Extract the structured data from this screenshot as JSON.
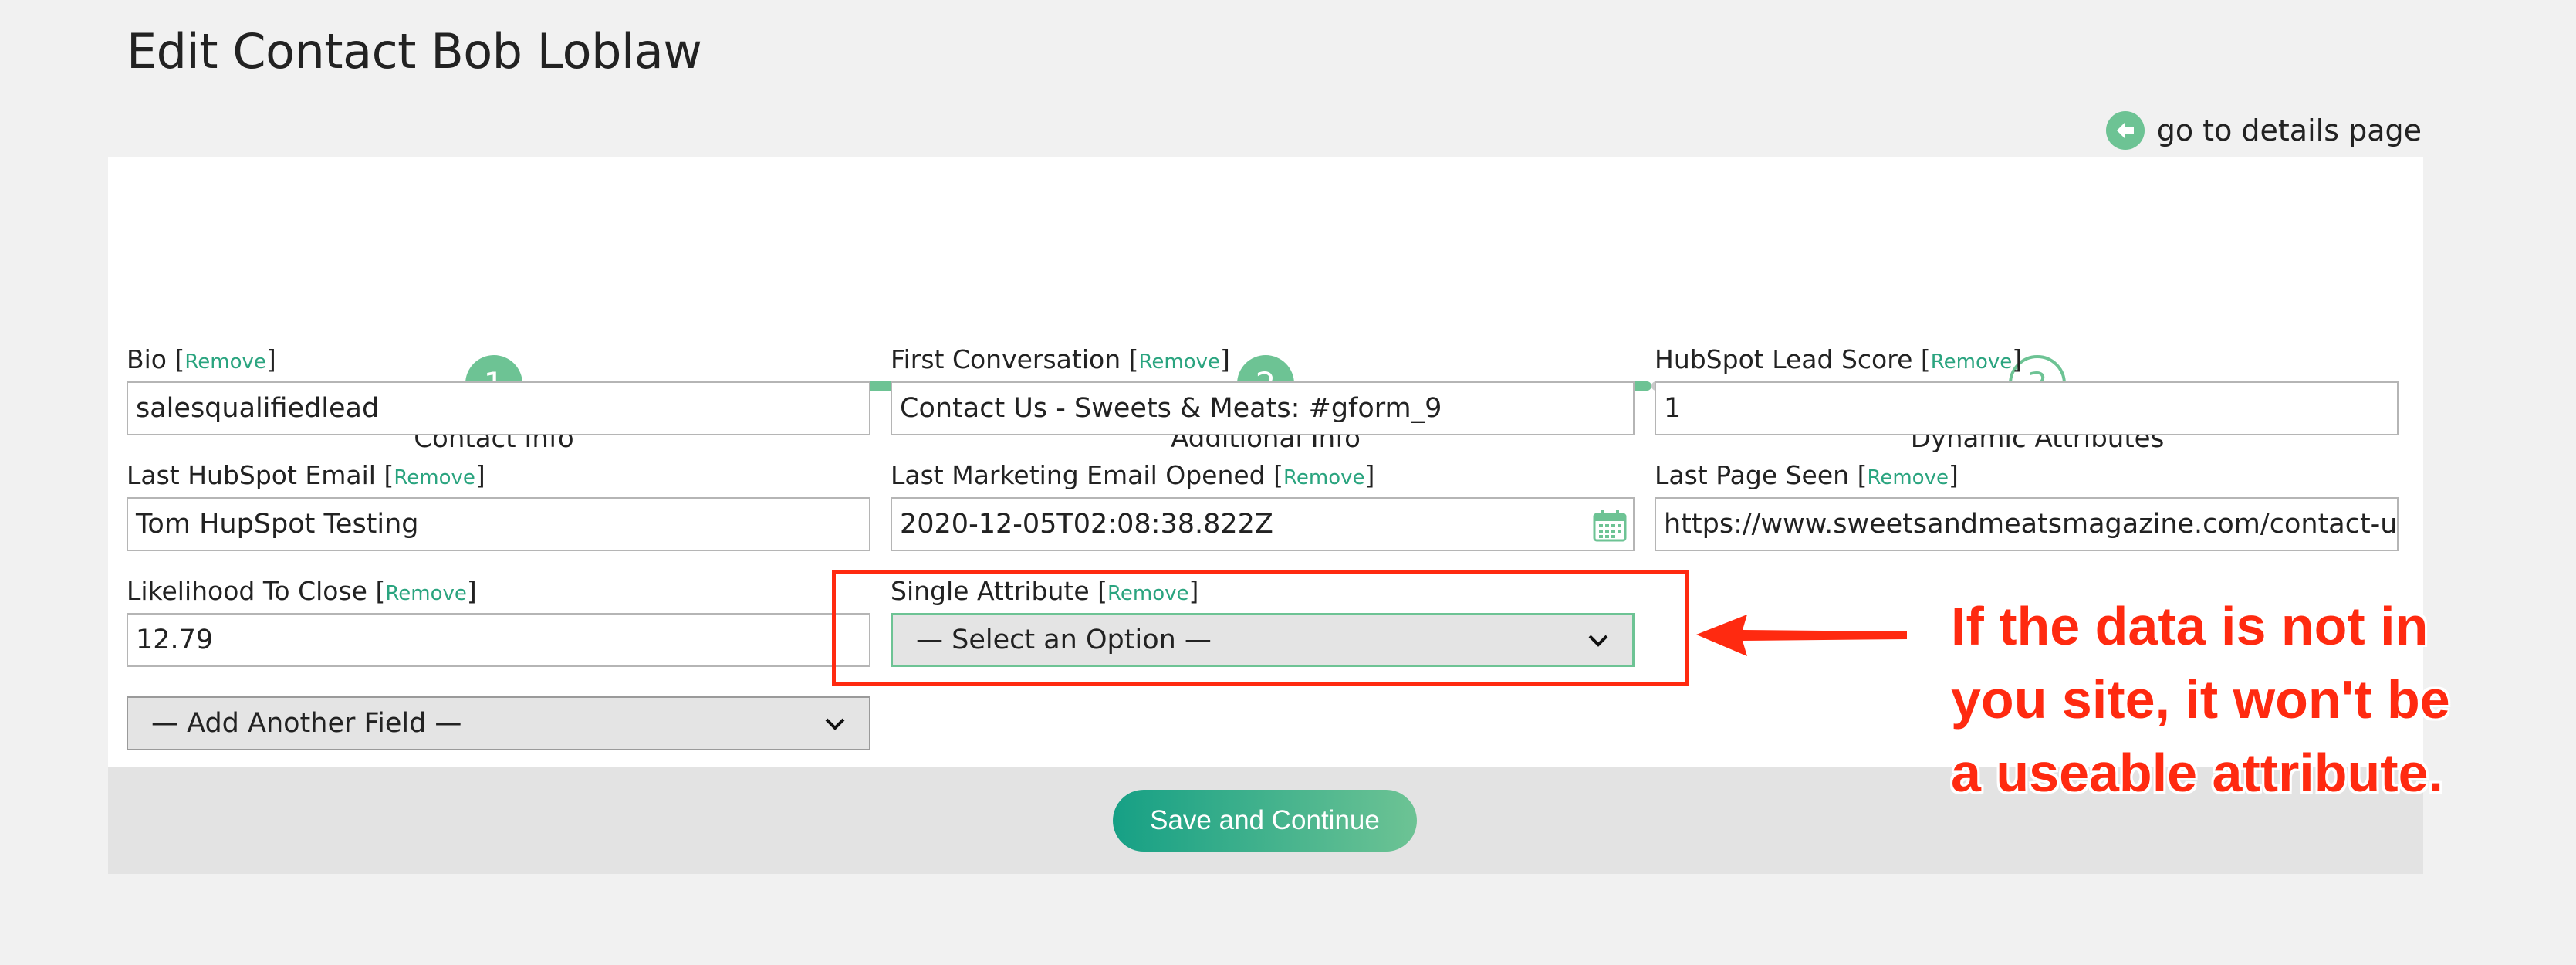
{
  "page": {
    "title": "Edit Contact Bob Loblaw",
    "details_link": "go to details page"
  },
  "steps": [
    {
      "number": "1",
      "label": "Contact Info",
      "state": "complete"
    },
    {
      "number": "2",
      "label": "Additional Info",
      "state": "complete"
    },
    {
      "number": "3",
      "label": "Dynamic Attributes",
      "state": "pending"
    }
  ],
  "remove_label": "Remove",
  "fields": {
    "bio": {
      "label": "Bio",
      "value": "salesqualifiedlead"
    },
    "first_conversation": {
      "label": "First Conversation",
      "value": "Contact Us - Sweets & Meats: #gform_9"
    },
    "hubspot_lead_score": {
      "label": "HubSpot Lead Score",
      "value": "1"
    },
    "last_hubspot_email": {
      "label": "Last HubSpot Email",
      "value": "Tom HupSpot Testing"
    },
    "last_marketing_email_opened": {
      "label": "Last Marketing Email Opened",
      "value": "2020-12-05T02:08:38.822Z"
    },
    "last_page_seen": {
      "label": "Last Page Seen",
      "value": "https://www.sweetsandmeatsmagazine.com/contact-us/"
    },
    "likelihood_to_close": {
      "label": "Likelihood To Close",
      "value": "12.79"
    },
    "single_attribute": {
      "label": "Single Attribute",
      "value": "— Select an Option —"
    }
  },
  "add_field": {
    "value": "— Add Another Field —"
  },
  "save_button": "Save and Continue",
  "annotation": {
    "line1": "If the data is not in",
    "line2": "you site, it won't be",
    "line3": "a useable attribute."
  },
  "colors": {
    "accent": "#6dc394",
    "link": "#2aa47f",
    "annotation": "#ff2a10"
  }
}
